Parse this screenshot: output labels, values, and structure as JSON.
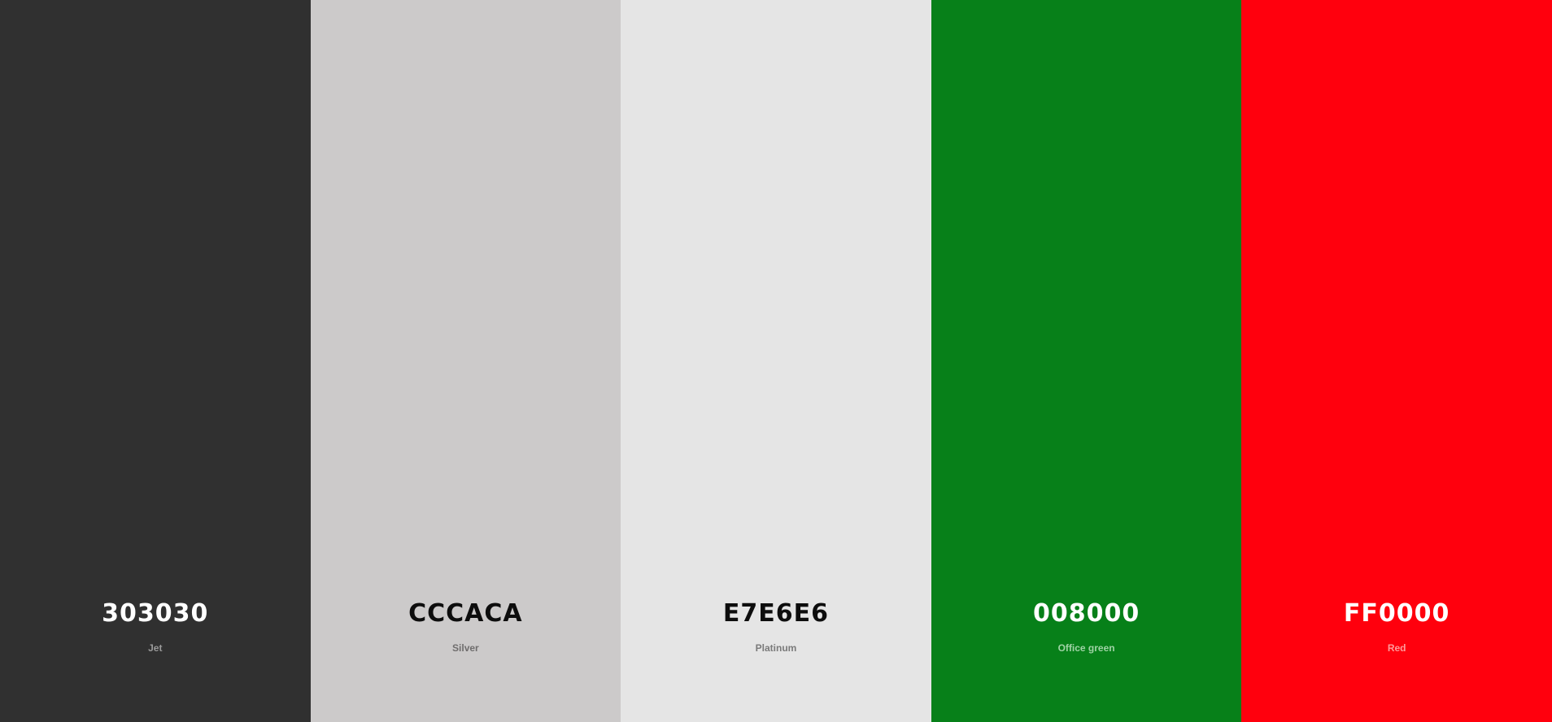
{
  "palette": {
    "swatches": [
      {
        "hex": "303030",
        "name": "Jet",
        "color": "#303030",
        "hex_color": "#ffffff",
        "name_color": "#9a9a9a"
      },
      {
        "hex": "CCCACA",
        "name": "Silver",
        "color": "#CCCACA",
        "hex_color": "#0d0d0d",
        "name_color": "#6f6d6d"
      },
      {
        "hex": "E7E6E6",
        "name": "Platinum",
        "color": "#E5E5E5",
        "hex_color": "#0d0d0d",
        "name_color": "#7a7a7a"
      },
      {
        "hex": "008000",
        "name": "Office green",
        "color": "#078019",
        "hex_color": "#ffffff",
        "name_color": "#9fd3a5"
      },
      {
        "hex": "FF0000",
        "name": "Red",
        "color": "#FF000D",
        "hex_color": "#ffffff",
        "name_color": "#ff9a9a"
      }
    ]
  }
}
